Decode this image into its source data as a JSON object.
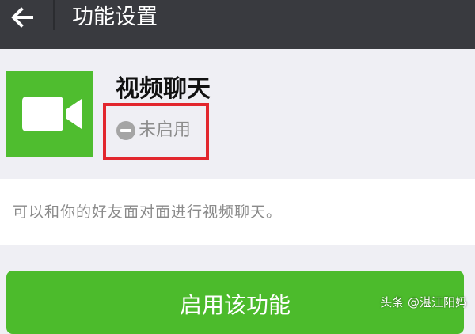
{
  "header": {
    "title": "功能设置",
    "back_icon": "arrow-left-icon",
    "background": "#393a3f"
  },
  "feature": {
    "name": "视频聊天",
    "icon": "video-camera-icon",
    "icon_background": "#4fbd2f",
    "status_icon": "minus-circle-icon",
    "status": "未启用",
    "highlight_color": "#e2262d"
  },
  "description": "可以和你的好友面对面进行视频聊天。",
  "enable_button": {
    "label": "启用该功能",
    "color": "#4cbb2c"
  },
  "watermark": "头条 @湛江阳妈"
}
